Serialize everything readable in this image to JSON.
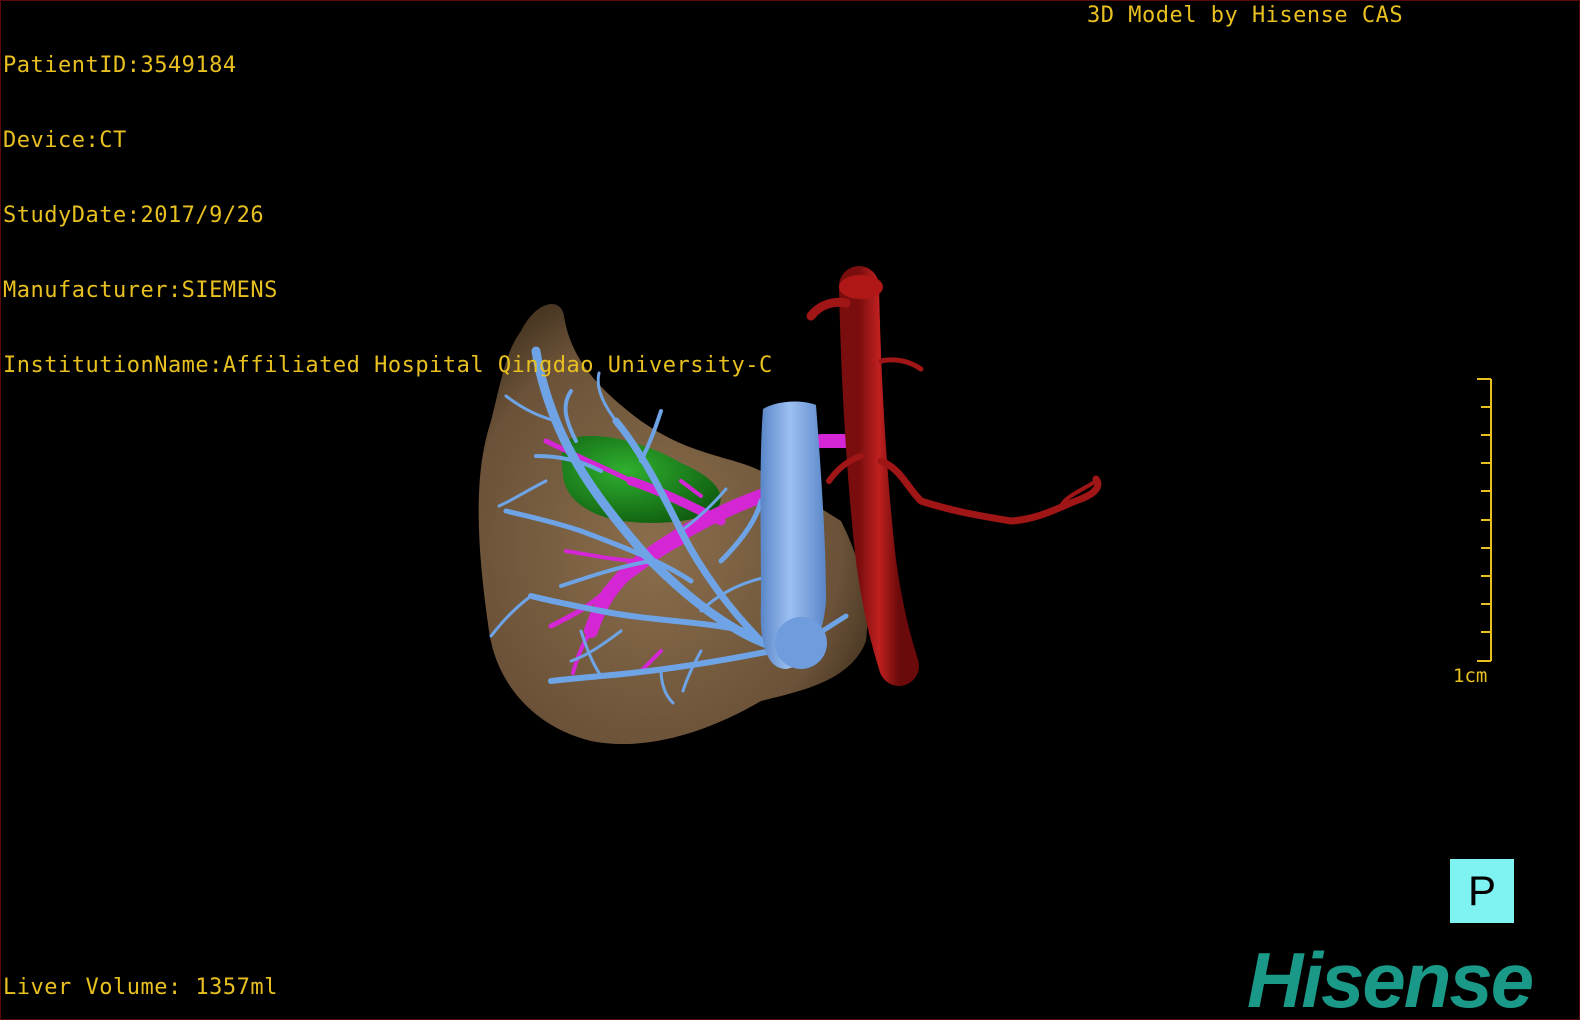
{
  "info": {
    "patient_id": "PatientID:3549184",
    "device": "Device:CT",
    "study_date": "StudyDate:2017/9/26",
    "manufacturer": "Manufacturer:SIEMENS",
    "institution": "InstitutionName:Affiliated Hospital Qingdao University-C"
  },
  "model_credit": "3D Model by Hisense CAS",
  "liver_volume": "Liver Volume: 1357ml",
  "scale_bar": {
    "label": "1cm"
  },
  "orientation": {
    "label": "P"
  },
  "brand": "Hisense",
  "colors": {
    "overlay_text": "#e8c020",
    "liver": "#7a6143",
    "portal_vein": "#d526d5",
    "hepatic_vein": "#6ea4e6",
    "ivc": "#7ba7e8",
    "aorta": "#b01818",
    "gallbladder": "#1f8a1f",
    "orientation_bg": "#7ff2f2",
    "brand": "#1a9988"
  }
}
